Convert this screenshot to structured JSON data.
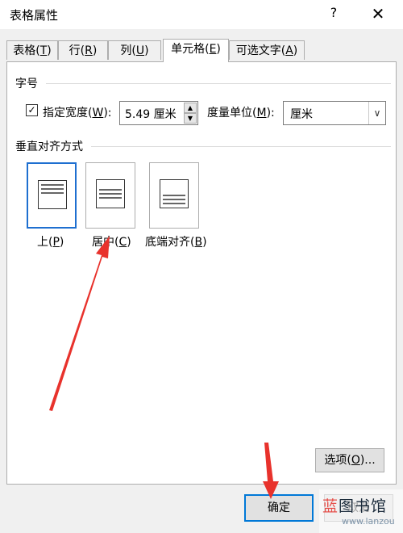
{
  "window": {
    "title": "表格属性",
    "help_icon": "?",
    "close_icon": "✕"
  },
  "tabs": [
    {
      "text": "表格",
      "key": "T",
      "close": ")"
    },
    {
      "text": "行",
      "key": "R",
      "close": ")"
    },
    {
      "text": "列",
      "key": "U",
      "close": ")"
    },
    {
      "text": "单元格",
      "key": "E",
      "close": ")",
      "active": true
    },
    {
      "text": "可选文字",
      "key": "A",
      "close": ")"
    }
  ],
  "size_section": {
    "title": "字号",
    "checkbox_checked": true,
    "width_label": {
      "text": "指定宽度",
      "key": "W",
      "close": "):"
    },
    "width_value": "5.49 厘米",
    "unit_label": {
      "text": "度量单位",
      "key": "M",
      "close": "):"
    },
    "unit_value": "厘米"
  },
  "valign_section": {
    "title": "垂直对齐方式",
    "options": [
      {
        "text": "上",
        "key": "P",
        "close": ")",
        "selected": true
      },
      {
        "text": "居中",
        "key": "C",
        "close": ")"
      },
      {
        "text": "底端对齐",
        "key": "B",
        "close": ")"
      }
    ]
  },
  "options_button": {
    "text": "选项",
    "key": "O",
    "close": ")..."
  },
  "footer": {
    "ok": "确定",
    "cancel": "取消"
  },
  "watermark": {
    "text_a": "蓝",
    "text_b": "图书馆",
    "sub": "www.lanzou"
  },
  "colors": {
    "accent": "#0078d7",
    "selected_border": "#1e6fd0",
    "arrow": "#e8322c"
  }
}
